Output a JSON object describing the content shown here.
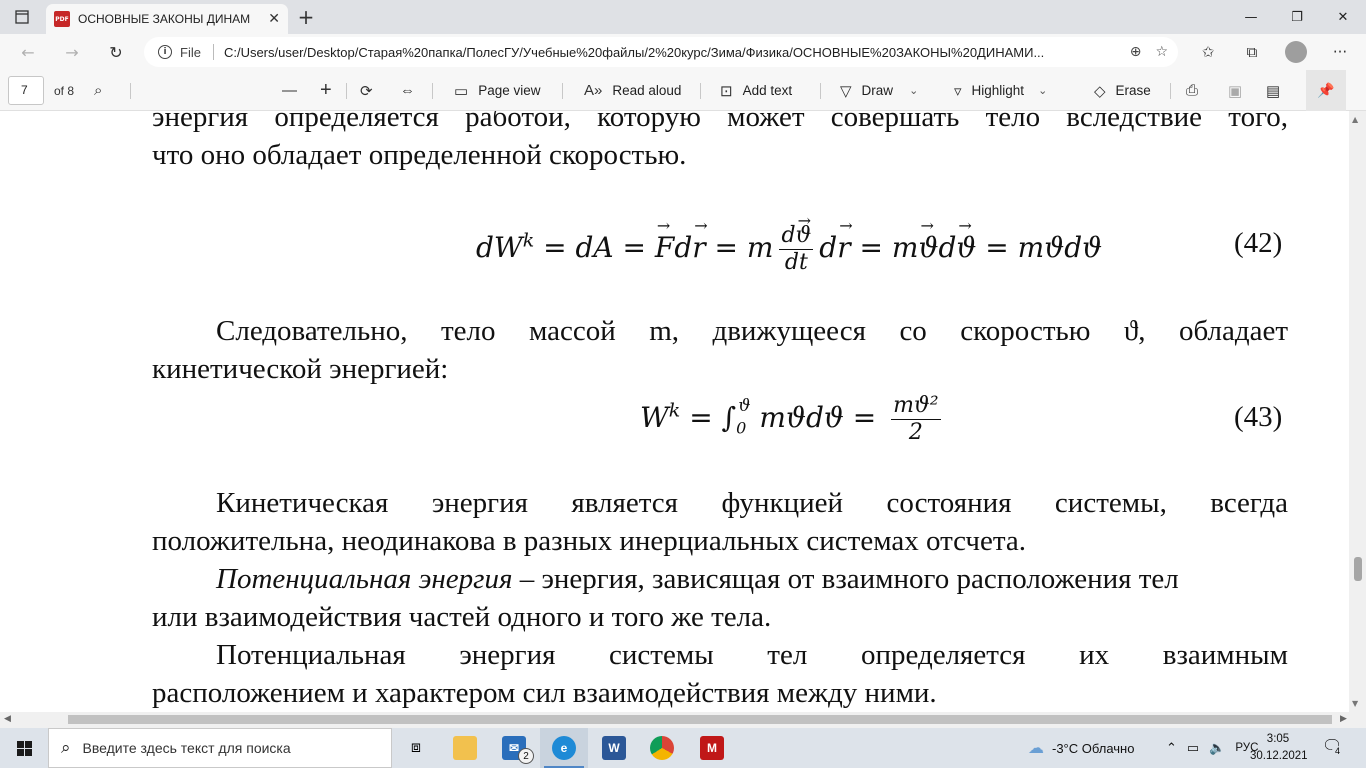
{
  "browser": {
    "tab_title": "ОСНОВНЫЕ ЗАКОНЫ ДИНАМИ",
    "tab_pdf_badge": "PDF",
    "file_label": "File",
    "url": "C:/Users/user/Desktop/Старая%20папка/ПолесГУ/Учебные%20файлы/2%20курс/Зима/Физика/ОСНОВНЫЕ%20ЗАКОНЫ%20ДИНАМИ...",
    "icons": [
      "sidebar-icon",
      "close-icon",
      "plus-icon",
      "minimize-icon",
      "maximize-icon",
      "back-icon",
      "forward-icon",
      "refresh-icon",
      "info-icon",
      "zoom-icon",
      "favorite-add-icon",
      "favorites-icon",
      "collections-icon",
      "profile-icon",
      "more-icon"
    ]
  },
  "pdf_toolbar": {
    "page_number": "7",
    "page_total": "of 8",
    "page_view": "Page view",
    "read_aloud": "Read aloud",
    "add_text": "Add text",
    "draw": "Draw",
    "highlight": "Highlight",
    "erase": "Erase"
  },
  "document": {
    "line1": "энергия определяется работой, которую может совершать тело вследствие того,",
    "line2": "что оно обладает определенной скоростью.",
    "eq42_number": "(42)",
    "eq43_number": "(43)",
    "line3": "Следовательно, тело массой m, движущееся со скоростью ϑ, обладает",
    "line4": "кинетической энергией:",
    "line5": "Кинетическая энергия является функцией состояния системы, всегда",
    "line6": "положительна, неодинакова в разных инерциальных системах отсчета.",
    "line7_italic": "Потенциальная энергия",
    "line7_rest": " – энергия, зависящая от взаимного расположения тел",
    "line8": "или взаимодействия частей одного и того же тела.",
    "line9": "Потенциальная энергия системы тел определяется их взаимным",
    "line10": "расположением и характером сил взаимодействия между ними."
  },
  "taskbar": {
    "search_placeholder": "Введите здесь текст для поиска",
    "mail_badge": "2",
    "weather": "-3°C  Облачно",
    "language": "РУС",
    "time": "3:05",
    "date": "30.12.2021",
    "notifications": "4"
  }
}
